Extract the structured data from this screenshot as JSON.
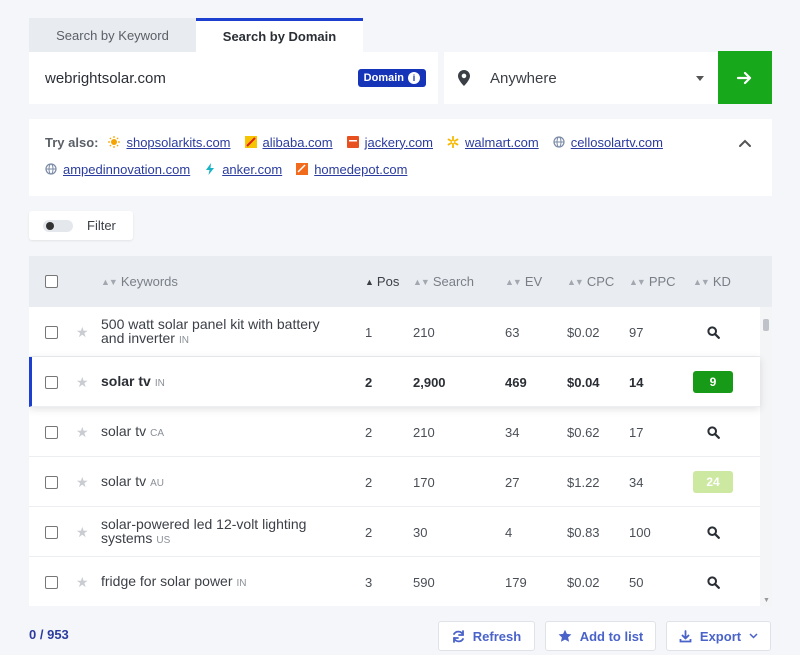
{
  "tabs": [
    {
      "label": "Search by Keyword",
      "active": false
    },
    {
      "label": "Search by Domain",
      "active": true
    }
  ],
  "search": {
    "value": "webrightsolar.com",
    "badge": "Domain",
    "badge_info": "i"
  },
  "location": {
    "value": "Anywhere"
  },
  "try_also": {
    "label": "Try also:",
    "line1": [
      "shopsolarkits.com",
      "alibaba.com",
      "jackery.com",
      "walmart.com",
      "cellosolartv.com"
    ],
    "line2": [
      "ampedinnovation.com",
      "anker.com",
      "homedepot.com"
    ]
  },
  "filter": {
    "label": "Filter"
  },
  "table": {
    "headers": {
      "keywords": "Keywords",
      "pos": "Pos",
      "search": "Search",
      "ev": "EV",
      "cpc": "CPC",
      "ppc": "PPC",
      "kd": "KD"
    },
    "rows": [
      {
        "kw1": "500 watt solar panel kit with battery",
        "kw2": "and inverter",
        "cc": "IN",
        "pos": "1",
        "search": "210",
        "ev": "63",
        "cpc": "$0.02",
        "ppc": "97",
        "kd": ""
      },
      {
        "kw1": "solar tv",
        "kw2": "",
        "cc": "IN",
        "pos": "2",
        "search": "2,900",
        "ev": "469",
        "cpc": "$0.04",
        "ppc": "14",
        "kd": "9"
      },
      {
        "kw1": "solar tv",
        "kw2": "",
        "cc": "CA",
        "pos": "2",
        "search": "210",
        "ev": "34",
        "cpc": "$0.62",
        "ppc": "17",
        "kd": ""
      },
      {
        "kw1": "solar tv",
        "kw2": "",
        "cc": "AU",
        "pos": "2",
        "search": "170",
        "ev": "27",
        "cpc": "$1.22",
        "ppc": "34",
        "kd": "24"
      },
      {
        "kw1": "solar-powered led 12-volt lighting",
        "kw2": "systems",
        "cc": "US",
        "pos": "2",
        "search": "30",
        "ev": "4",
        "cpc": "$0.83",
        "ppc": "100",
        "kd": ""
      },
      {
        "kw1": "fridge for solar power",
        "kw2": "",
        "cc": "IN",
        "pos": "3",
        "search": "590",
        "ev": "179",
        "cpc": "$0.02",
        "ppc": "50",
        "kd": ""
      }
    ]
  },
  "footer": {
    "selected": "0",
    "total": "/ 953",
    "refresh": "Refresh",
    "add_to_list": "Add to list",
    "export": "Export"
  },
  "colors": {
    "accent": "#1c3fd0",
    "go": "#17a81c",
    "kd_low": "#179a17",
    "kd_easy": "#cde8a0",
    "link": "#2b3c9e"
  }
}
